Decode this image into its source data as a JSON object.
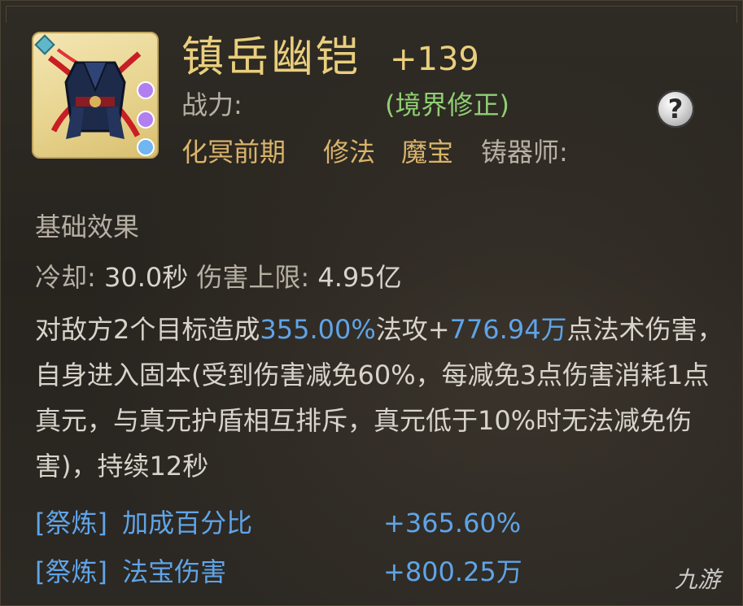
{
  "item": {
    "name": "镇岳幽铠",
    "level": "+139",
    "power_label": "战力:",
    "power_note": "(境界修正)",
    "help": "?",
    "realm": "化冥前期",
    "path": "修法",
    "type": "魔宝",
    "maker": "铸器师:"
  },
  "effects": {
    "heading": "基础效果",
    "cooldown_label": "冷却:",
    "cooldown_value": "30.0秒",
    "dmg_cap_label": "伤害上限:",
    "dmg_cap_value": "4.95亿",
    "desc_1": "对敌方2个目标造成",
    "desc_pct": "355.00%",
    "desc_2": "法攻+",
    "desc_flat": "776.94万",
    "desc_3": "点法术伤害，自身进入固本(受到伤害减免60%，每减免3点伤害消耗1点真元，与真元护盾相互排斥，真元低于10%时无法减免伤害)，持续12秒"
  },
  "refine": [
    {
      "tag": "[祭炼]",
      "label": "加成百分比",
      "value": "+365.60%"
    },
    {
      "tag": "[祭炼]",
      "label": "法宝伤害",
      "value": "+800.25万"
    }
  ],
  "watermark": "九游",
  "colors": {
    "title_gold": "#e9cf7d",
    "green": "#8fcf72",
    "blue": "#5fa4e8",
    "gray": "#b6afa3",
    "icon_bg": "#e8d48f"
  }
}
